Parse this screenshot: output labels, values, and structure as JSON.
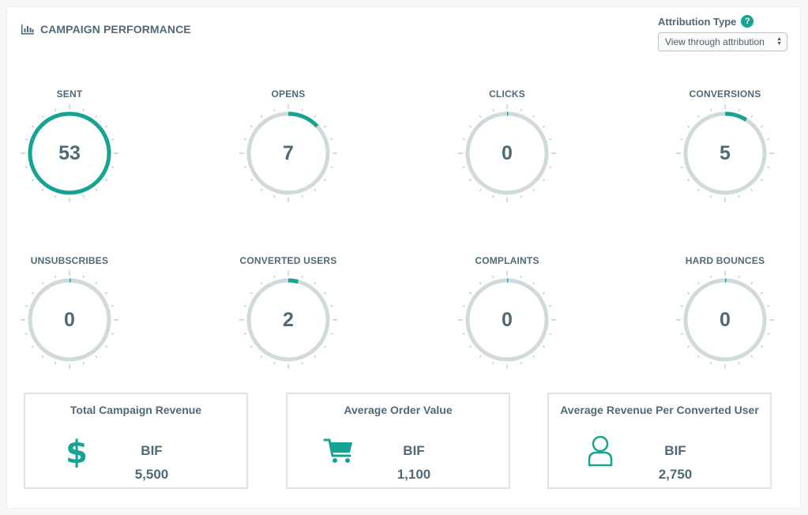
{
  "header": {
    "title": "CAMPAIGN PERFORMANCE",
    "attribution_label": "Attribution Type",
    "attribution_value": "View through attribution"
  },
  "metrics": [
    {
      "label": "SENT",
      "value": "53",
      "fraction": 1.0
    },
    {
      "label": "OPENS",
      "value": "7",
      "fraction": 0.13
    },
    {
      "label": "CLICKS",
      "value": "0",
      "fraction": 0.0
    },
    {
      "label": "CONVERSIONS",
      "value": "5",
      "fraction": 0.09
    },
    {
      "label": "UNSUBSCRIBES",
      "value": "0",
      "fraction": 0.0
    },
    {
      "label": "CONVERTED USERS",
      "value": "2",
      "fraction": 0.04
    },
    {
      "label": "COMPLAINTS",
      "value": "0",
      "fraction": 0.0
    },
    {
      "label": "HARD BOUNCES",
      "value": "0",
      "fraction": 0.0
    }
  ],
  "revenue": [
    {
      "title": "Total Campaign Revenue",
      "currency": "BIF",
      "value": "5,500",
      "icon": "dollar-icon"
    },
    {
      "title": "Average Order Value",
      "currency": "BIF",
      "value": "1,100",
      "icon": "cart-icon"
    },
    {
      "title": "Average Revenue Per Converted User",
      "currency": "BIF",
      "value": "2,750",
      "icon": "user-icon"
    }
  ],
  "colors": {
    "accent": "#16a392",
    "track": "#d0dadd",
    "text": "#506976"
  }
}
